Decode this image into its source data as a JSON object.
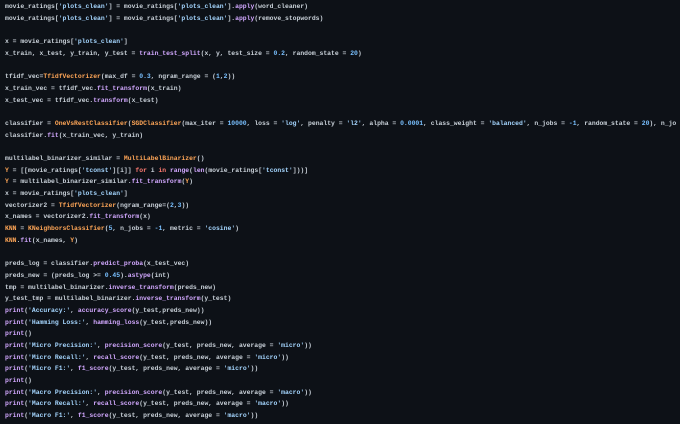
{
  "colors": {
    "background": "#0d1117",
    "plain": "#c9d1d9",
    "function": "#d2a8ff",
    "string": "#a5d6ff",
    "number": "#79c0ff",
    "class": "#ffa657",
    "keyword": "#ff7b72"
  },
  "code": {
    "lines": [
      [
        [
          "p",
          "movie_ratings["
        ],
        [
          "s",
          "'plots_clean'"
        ],
        [
          "p",
          "] = movie_ratings["
        ],
        [
          "s",
          "'plots_clean'"
        ],
        [
          "p",
          "]."
        ],
        [
          "f",
          "apply"
        ],
        [
          "p",
          "(word_cleaner)"
        ]
      ],
      [
        [
          "p",
          "movie_ratings["
        ],
        [
          "s",
          "'plots_clean'"
        ],
        [
          "p",
          "] = movie_ratings["
        ],
        [
          "s",
          "'plots_clean'"
        ],
        [
          "p",
          "]."
        ],
        [
          "f",
          "apply"
        ],
        [
          "p",
          "(remove_stopwords)"
        ]
      ],
      [],
      [
        [
          "p",
          "x = movie_ratings["
        ],
        [
          "s",
          "'plots_clean'"
        ],
        [
          "p",
          "]"
        ]
      ],
      [
        [
          "p",
          "x_train, x_test, y_train, y_test = "
        ],
        [
          "f",
          "train_test_split"
        ],
        [
          "p",
          "(x, y, test_size = "
        ],
        [
          "n",
          "0.2"
        ],
        [
          "p",
          ", random_state = "
        ],
        [
          "n",
          "20"
        ],
        [
          "p",
          ")"
        ]
      ],
      [],
      [
        [
          "p",
          "tfidf_vec="
        ],
        [
          "c",
          "TfidfVectorizer"
        ],
        [
          "p",
          "(max_df = "
        ],
        [
          "n",
          "0.3"
        ],
        [
          "p",
          ", ngram_range = ("
        ],
        [
          "n",
          "1"
        ],
        [
          "p",
          ","
        ],
        [
          "n",
          "2"
        ],
        [
          "p",
          "))"
        ]
      ],
      [
        [
          "p",
          "x_train_vec = tfidf_vec."
        ],
        [
          "f",
          "fit_transform"
        ],
        [
          "p",
          "(x_train)"
        ]
      ],
      [
        [
          "p",
          "x_test_vec = tfidf_vec."
        ],
        [
          "f",
          "transform"
        ],
        [
          "p",
          "(x_test)"
        ]
      ],
      [],
      [
        [
          "p",
          "classifier = "
        ],
        [
          "c",
          "OneVsRestClassifier"
        ],
        [
          "p",
          "("
        ],
        [
          "c",
          "SGDClassifier"
        ],
        [
          "p",
          "(max_iter = "
        ],
        [
          "n",
          "10000"
        ],
        [
          "p",
          ", loss = "
        ],
        [
          "s",
          "'log'"
        ],
        [
          "p",
          ", penalty = "
        ],
        [
          "s",
          "'l2'"
        ],
        [
          "p",
          ", alpha = "
        ],
        [
          "n",
          "0.0001"
        ],
        [
          "p",
          ", class_weight = "
        ],
        [
          "s",
          "'balanced'"
        ],
        [
          "p",
          ", n_jobs = "
        ],
        [
          "n",
          "-1"
        ],
        [
          "p",
          ", random_state = "
        ],
        [
          "n",
          "20"
        ],
        [
          "p",
          "), n_jo"
        ]
      ],
      [
        [
          "p",
          "classifier."
        ],
        [
          "f",
          "fit"
        ],
        [
          "p",
          "(x_train_vec, y_train)"
        ]
      ],
      [],
      [
        [
          "p",
          "multilabel_binarizer_similar = "
        ],
        [
          "c",
          "MultiLabelBinarizer"
        ],
        [
          "p",
          "()"
        ]
      ],
      [
        [
          "c",
          "Y"
        ],
        [
          "p",
          " = [[movie_ratings["
        ],
        [
          "s",
          "'tconst'"
        ],
        [
          "p",
          "][i]] "
        ],
        [
          "k",
          "for"
        ],
        [
          "p",
          " i "
        ],
        [
          "k",
          "in"
        ],
        [
          "p",
          " "
        ],
        [
          "f",
          "range"
        ],
        [
          "p",
          "("
        ],
        [
          "f",
          "len"
        ],
        [
          "p",
          "(movie_ratings["
        ],
        [
          "s",
          "'tconst'"
        ],
        [
          "p",
          "]))]"
        ]
      ],
      [
        [
          "c",
          "Y"
        ],
        [
          "p",
          " = multilabel_binarizer_similar."
        ],
        [
          "f",
          "fit_transform"
        ],
        [
          "p",
          "("
        ],
        [
          "c",
          "Y"
        ],
        [
          "p",
          ")"
        ]
      ],
      [
        [
          "p",
          "x = movie_ratings["
        ],
        [
          "s",
          "'plots_clean'"
        ],
        [
          "p",
          "]"
        ]
      ],
      [
        [
          "p",
          "vectorizer2 = "
        ],
        [
          "c",
          "TfidfVectorizer"
        ],
        [
          "p",
          "(ngram_range=("
        ],
        [
          "n",
          "2"
        ],
        [
          "p",
          ","
        ],
        [
          "n",
          "3"
        ],
        [
          "p",
          "))"
        ]
      ],
      [
        [
          "p",
          "x_names = vectorizer2."
        ],
        [
          "f",
          "fit_transform"
        ],
        [
          "p",
          "(x)"
        ]
      ],
      [
        [
          "c",
          "KNN"
        ],
        [
          "p",
          " = "
        ],
        [
          "c",
          "KNeighborsClassifier"
        ],
        [
          "p",
          "("
        ],
        [
          "n",
          "5"
        ],
        [
          "p",
          ", n_jobs = "
        ],
        [
          "n",
          "-1"
        ],
        [
          "p",
          ", metric = "
        ],
        [
          "s",
          "'cosine'"
        ],
        [
          "p",
          ")"
        ]
      ],
      [
        [
          "c",
          "KNN"
        ],
        [
          "p",
          "."
        ],
        [
          "f",
          "fit"
        ],
        [
          "p",
          "(x_names, "
        ],
        [
          "c",
          "Y"
        ],
        [
          "p",
          ")"
        ]
      ],
      [],
      [
        [
          "p",
          "preds_log = classifier."
        ],
        [
          "f",
          "predict_proba"
        ],
        [
          "p",
          "(x_test_vec)"
        ]
      ],
      [
        [
          "p",
          "preds_new = (preds_log >= "
        ],
        [
          "n",
          "0.45"
        ],
        [
          "p",
          ")."
        ],
        [
          "f",
          "astype"
        ],
        [
          "p",
          "(int)"
        ]
      ],
      [
        [
          "p",
          "tmp = multilabel_binarizer."
        ],
        [
          "f",
          "inverse_transform"
        ],
        [
          "p",
          "(preds_new)"
        ]
      ],
      [
        [
          "p",
          "y_test_tmp = multilabel_binarizer."
        ],
        [
          "f",
          "inverse_transform"
        ],
        [
          "p",
          "(y_test)"
        ]
      ],
      [
        [
          "f",
          "print"
        ],
        [
          "p",
          "("
        ],
        [
          "s",
          "'Accuracy:'"
        ],
        [
          "p",
          ", "
        ],
        [
          "f",
          "accuracy_score"
        ],
        [
          "p",
          "(y_test,preds_new))"
        ]
      ],
      [
        [
          "f",
          "print"
        ],
        [
          "p",
          "("
        ],
        [
          "s",
          "'Hamming Loss:'"
        ],
        [
          "p",
          ", "
        ],
        [
          "f",
          "hamming_loss"
        ],
        [
          "p",
          "(y_test,preds_new))"
        ]
      ],
      [
        [
          "f",
          "print"
        ],
        [
          "p",
          "()"
        ]
      ],
      [
        [
          "f",
          "print"
        ],
        [
          "p",
          "("
        ],
        [
          "s",
          "'Micro Precision:'"
        ],
        [
          "p",
          ", "
        ],
        [
          "f",
          "precision_score"
        ],
        [
          "p",
          "(y_test, preds_new, average = "
        ],
        [
          "s",
          "'micro'"
        ],
        [
          "p",
          "))"
        ]
      ],
      [
        [
          "f",
          "print"
        ],
        [
          "p",
          "("
        ],
        [
          "s",
          "'Micro Recall:'"
        ],
        [
          "p",
          ", "
        ],
        [
          "f",
          "recall_score"
        ],
        [
          "p",
          "(y_test, preds_new, average = "
        ],
        [
          "s",
          "'micro'"
        ],
        [
          "p",
          "))"
        ]
      ],
      [
        [
          "f",
          "print"
        ],
        [
          "p",
          "("
        ],
        [
          "s",
          "'Micro F1:'"
        ],
        [
          "p",
          ", "
        ],
        [
          "f",
          "f1_score"
        ],
        [
          "p",
          "(y_test, preds_new, average = "
        ],
        [
          "s",
          "'micro'"
        ],
        [
          "p",
          "))"
        ]
      ],
      [
        [
          "f",
          "print"
        ],
        [
          "p",
          "()"
        ]
      ],
      [
        [
          "f",
          "print"
        ],
        [
          "p",
          "("
        ],
        [
          "s",
          "'Macro Precision:'"
        ],
        [
          "p",
          ", "
        ],
        [
          "f",
          "precision_score"
        ],
        [
          "p",
          "(y_test, preds_new, average = "
        ],
        [
          "s",
          "'macro'"
        ],
        [
          "p",
          "))"
        ]
      ],
      [
        [
          "f",
          "print"
        ],
        [
          "p",
          "("
        ],
        [
          "s",
          "'Macro Recall:'"
        ],
        [
          "p",
          ", "
        ],
        [
          "f",
          "recall_score"
        ],
        [
          "p",
          "(y_test, preds_new, average = "
        ],
        [
          "s",
          "'macro'"
        ],
        [
          "p",
          "))"
        ]
      ],
      [
        [
          "f",
          "print"
        ],
        [
          "p",
          "("
        ],
        [
          "s",
          "'Macro F1:'"
        ],
        [
          "p",
          ", "
        ],
        [
          "f",
          "f1_score"
        ],
        [
          "p",
          "(y_test, preds_new, average = "
        ],
        [
          "s",
          "'macro'"
        ],
        [
          "p",
          "))"
        ]
      ]
    ]
  }
}
